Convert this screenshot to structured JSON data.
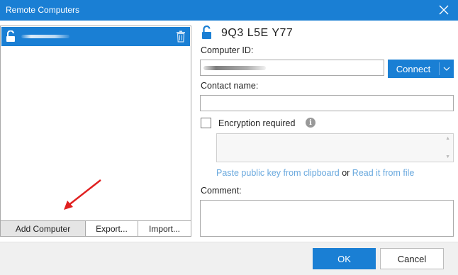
{
  "window": {
    "title": "Remote Computers",
    "accent_color": "#1a7fd4",
    "close_icon": "close-icon"
  },
  "computer_list": {
    "items": [
      {
        "name_redacted": true,
        "icon": "unlocked-padlock-icon",
        "delete_icon": "trash-icon",
        "selected": true
      }
    ],
    "buttons": {
      "add": "Add Computer",
      "export": "Export...",
      "import": "Import..."
    }
  },
  "details": {
    "header_id": "9Q3 L5E Y77",
    "header_icon": "unlocked-padlock-icon",
    "computer_id_label": "Computer ID:",
    "computer_id_value_redacted": true,
    "connect_label": "Connect",
    "contact_name_label": "Contact name:",
    "contact_name_value": "",
    "encryption_label": "Encryption required",
    "encryption_checked": false,
    "info_icon": "info-icon",
    "public_key_value": "",
    "paste_link": "Paste public key from clipboard",
    "or_text": "or",
    "read_link": "Read it from file",
    "comment_label": "Comment:",
    "comment_value": ""
  },
  "footer": {
    "ok": "OK",
    "cancel": "Cancel"
  }
}
